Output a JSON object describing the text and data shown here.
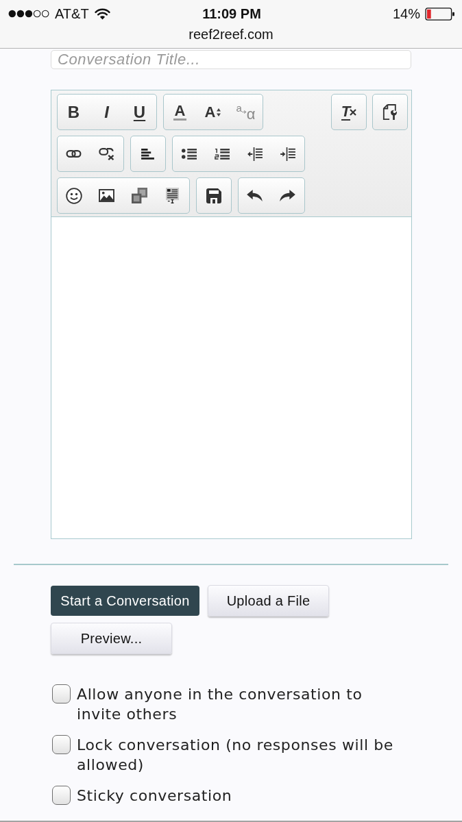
{
  "status_bar": {
    "carrier": "AT&T",
    "time": "11:09 PM",
    "battery": "14%"
  },
  "address_bar": {
    "url": "reef2reef.com"
  },
  "title_field": {
    "placeholder": "Conversation Title..."
  },
  "editor": {
    "toolbar": [
      {
        "groups": [
          [
            {
              "kind": "bold",
              "glyphs": [
                "B"
              ]
            },
            {
              "kind": "italic",
              "glyphs": [
                "I"
              ]
            },
            {
              "kind": "underline",
              "glyphs": [
                "U"
              ]
            }
          ],
          [
            {
              "kind": "text-color",
              "glyphs": [
                "A"
              ]
            },
            {
              "kind": "font-size",
              "glyphs": [
                "A"
              ]
            },
            {
              "kind": "special-characters",
              "glyphs": [
                "a",
                "α"
              ]
            }
          ]
        ],
        "end_groups": [
          [
            {
              "kind": "remove-format",
              "glyphs": [
                "T"
              ]
            }
          ],
          [
            {
              "kind": "source"
            }
          ]
        ]
      },
      {
        "groups": [
          [
            {
              "kind": "link"
            },
            {
              "kind": "unlink"
            }
          ],
          [
            {
              "kind": "align-left"
            }
          ],
          [
            {
              "kind": "bulleted-list"
            },
            {
              "kind": "numbered-list"
            },
            {
              "kind": "outdent"
            },
            {
              "kind": "indent"
            }
          ]
        ]
      },
      {
        "groups": [
          [
            {
              "kind": "smilies"
            },
            {
              "kind": "image"
            },
            {
              "kind": "media"
            },
            {
              "kind": "template"
            }
          ],
          [
            {
              "kind": "save-draft"
            }
          ],
          [
            {
              "kind": "undo"
            },
            {
              "kind": "redo"
            }
          ]
        ]
      }
    ]
  },
  "actions": [
    {
      "label": "Start a Conversation",
      "kind": "primary"
    },
    {
      "label": "Upload a File",
      "kind": "secondary"
    },
    {
      "label": "Preview...",
      "kind": "secondary"
    }
  ],
  "options": [
    {
      "label": "Allow anyone in the conversation to invite others",
      "checked": false
    },
    {
      "label": "Lock conversation (no responses will be allowed)",
      "checked": false
    },
    {
      "label": "Sticky conversation",
      "checked": false
    }
  ]
}
